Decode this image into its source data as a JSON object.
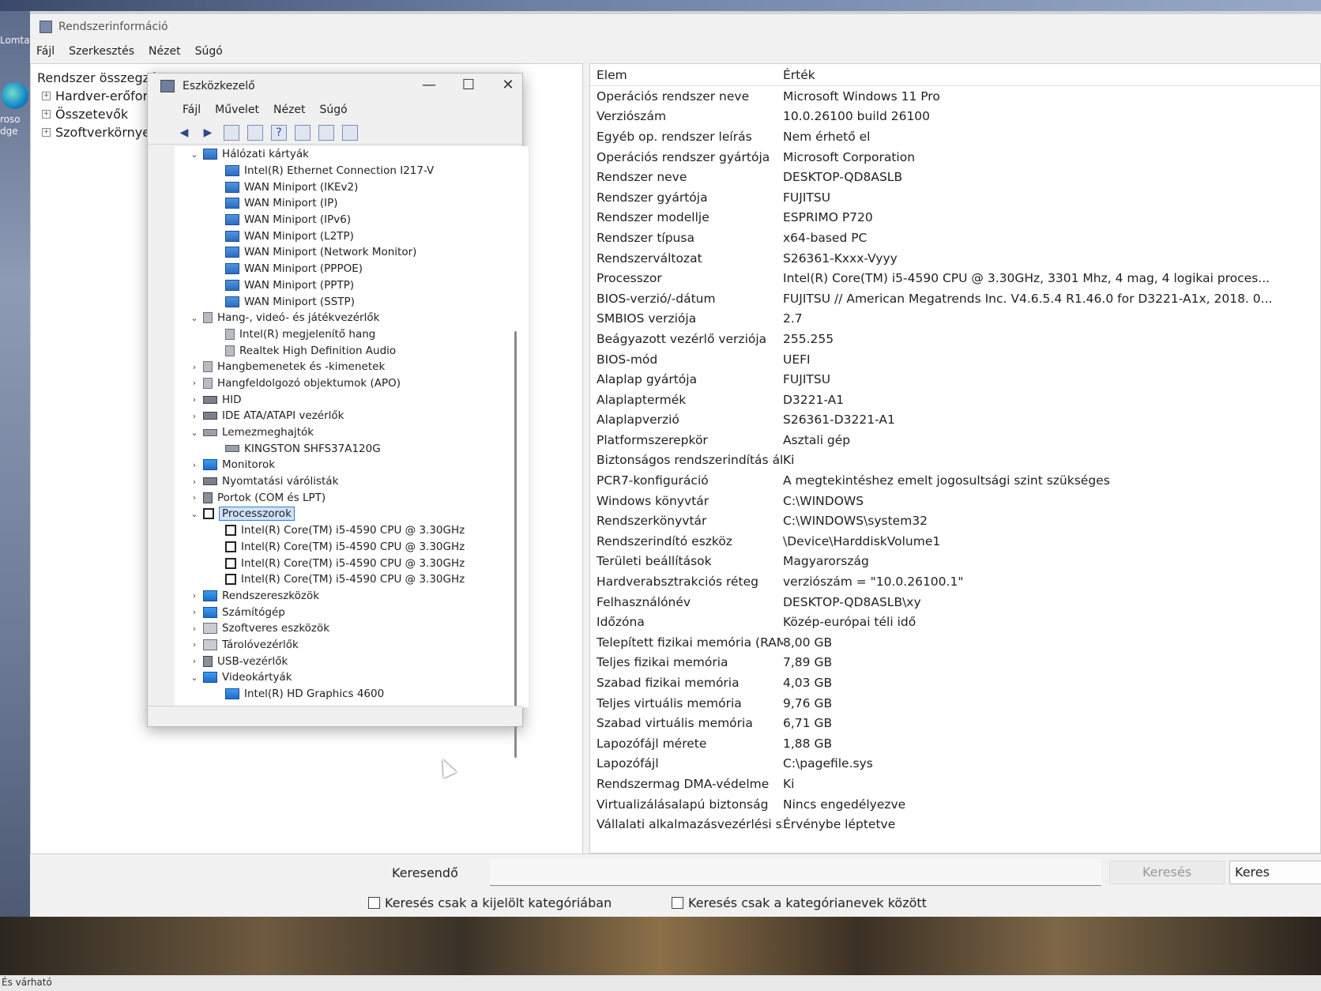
{
  "desktop": {
    "top_left_label": "Lomta",
    "left_labels": [
      "roso",
      "dge"
    ],
    "taskbar_text": "És várható"
  },
  "window": {
    "title": "Rendszerinformáció",
    "menu": [
      "Fájl",
      "Szerkesztés",
      "Nézet",
      "Súgó"
    ]
  },
  "tree": {
    "root": "Rendszer összegzése",
    "children": [
      "Hardver-erőforrások",
      "Összetevők",
      "Szoftverkörnyezet"
    ]
  },
  "info": {
    "col_elem": "Elem",
    "col_val": "Érték",
    "rows": [
      [
        "Operációs rendszer neve",
        "Microsoft Windows 11 Pro"
      ],
      [
        "Verziószám",
        "10.0.26100 build 26100"
      ],
      [
        "Egyéb op. rendszer leírás",
        "Nem érhető el"
      ],
      [
        "Operációs rendszer gyártója",
        "Microsoft Corporation"
      ],
      [
        "Rendszer neve",
        "DESKTOP-QD8ASLB"
      ],
      [
        "Rendszer gyártója",
        "FUJITSU"
      ],
      [
        "Rendszer modellje",
        "ESPRIMO P720"
      ],
      [
        "Rendszer típusa",
        "x64-based PC"
      ],
      [
        "Rendszerváltozat",
        "S26361-Kxxx-Vyyy"
      ],
      [
        "Processzor",
        "Intel(R) Core(TM) i5-4590 CPU @ 3.30GHz, 3301 Mhz, 4 mag, 4 logikai proces..."
      ],
      [
        "BIOS-verzió/-dátum",
        "FUJITSU // American Megatrends Inc. V4.6.5.4 R1.46.0 for D3221-A1x, 2018. 0..."
      ],
      [
        "SMBIOS verziója",
        "2.7"
      ],
      [
        "Beágyazott vezérlő verziója",
        "255.255"
      ],
      [
        "BIOS-mód",
        "UEFI"
      ],
      [
        "Alaplap gyártója",
        "FUJITSU"
      ],
      [
        "Alaplaptermék",
        "D3221-A1"
      ],
      [
        "Alaplapverzió",
        "S26361-D3221-A1"
      ],
      [
        "Platformszerepkör",
        "Asztali gép"
      ],
      [
        "Biztonságos rendszerindítás áll...",
        "Ki"
      ],
      [
        "PCR7-konfiguráció",
        "A megtekintéshez emelt jogosultsági szint szükséges"
      ],
      [
        "Windows könyvtár",
        "C:\\WINDOWS"
      ],
      [
        "Rendszerkönyvtár",
        "C:\\WINDOWS\\system32"
      ],
      [
        "Rendszerindító eszköz",
        "\\Device\\HarddiskVolume1"
      ],
      [
        "Területi beállítások",
        "Magyarország"
      ],
      [
        "Hardverabsztrakciós réteg",
        "verziószám = \"10.0.26100.1\""
      ],
      [
        "Felhasználónév",
        "DESKTOP-QD8ASLB\\xy"
      ],
      [
        "Időzóna",
        "Közép-európai téli idő"
      ],
      [
        "Telepített fizikai memória (RAM)",
        "8,00 GB"
      ],
      [
        "Teljes fizikai memória",
        "7,89 GB"
      ],
      [
        "Szabad fizikai memória",
        "4,03 GB"
      ],
      [
        "Teljes virtuális memória",
        "9,76 GB"
      ],
      [
        "Szabad virtuális memória",
        "6,71 GB"
      ],
      [
        "Lapozófájl mérete",
        "1,88 GB"
      ],
      [
        "Lapozófájl",
        "C:\\pagefile.sys"
      ],
      [
        "Rendszermag DMA-védelme",
        "Ki"
      ],
      [
        "Virtualizálásalapú biztonság",
        "Nincs engedélyezve"
      ],
      [
        "Vállalati alkalmazásvezérlési sz...",
        "Érvénybe léptetve"
      ]
    ]
  },
  "search": {
    "label": "Keresendő",
    "value": "",
    "btn_search_disabled": "Keresés",
    "btn_search": "Keres",
    "chk_selected": "Keresés csak a kijelölt kategóriában",
    "chk_names": "Keresés csak a kategórianevek között"
  },
  "devmgr": {
    "title": "Eszközkezelő",
    "menu": [
      "Fájl",
      "Művelet",
      "Nézet",
      "Súgó"
    ],
    "controls": [
      "—",
      "☐",
      "✕"
    ],
    "nodes": [
      {
        "label": "Hálózati kártyák",
        "chev": "v",
        "icon": "net",
        "indent": 0
      },
      {
        "label": "Intel(R) Ethernet Connection I217-V",
        "chev": "",
        "icon": "net",
        "indent": 1
      },
      {
        "label": "WAN Miniport (IKEv2)",
        "chev": "",
        "icon": "net",
        "indent": 1
      },
      {
        "label": "WAN Miniport (IP)",
        "chev": "",
        "icon": "net",
        "indent": 1
      },
      {
        "label": "WAN Miniport (IPv6)",
        "chev": "",
        "icon": "net",
        "indent": 1
      },
      {
        "label": "WAN Miniport (L2TP)",
        "chev": "",
        "icon": "net",
        "indent": 1
      },
      {
        "label": "WAN Miniport (Network Monitor)",
        "chev": "",
        "icon": "net",
        "indent": 1
      },
      {
        "label": "WAN Miniport (PPPOE)",
        "chev": "",
        "icon": "net",
        "indent": 1
      },
      {
        "label": "WAN Miniport (PPTP)",
        "chev": "",
        "icon": "net",
        "indent": 1
      },
      {
        "label": "WAN Miniport (SSTP)",
        "chev": "",
        "icon": "net",
        "indent": 1
      },
      {
        "label": "Hang-, videó- és játékvezérlők",
        "chev": "v",
        "icon": "snd",
        "indent": 0
      },
      {
        "label": "Intel(R) megjelenítő hang",
        "chev": "",
        "icon": "snd",
        "indent": 1
      },
      {
        "label": "Realtek High Definition Audio",
        "chev": "",
        "icon": "snd",
        "indent": 1
      },
      {
        "label": "Hangbemenetek és -kimenetek",
        "chev": ">",
        "icon": "snd",
        "indent": 0
      },
      {
        "label": "Hangfeldolgozó objektumok (APO)",
        "chev": ">",
        "icon": "snd",
        "indent": 0
      },
      {
        "label": "HID",
        "chev": ">",
        "icon": "hid",
        "indent": 0
      },
      {
        "label": "IDE ATA/ATAPI vezérlők",
        "chev": ">",
        "icon": "hid",
        "indent": 0
      },
      {
        "label": "Lemezmeghajtók",
        "chev": "v",
        "icon": "disk",
        "indent": 0
      },
      {
        "label": "KINGSTON SHFS37A120G",
        "chev": "",
        "icon": "disk",
        "indent": 1
      },
      {
        "label": "Monitorok",
        "chev": ">",
        "icon": "mon",
        "indent": 0
      },
      {
        "label": "Nyomtatási várólisták",
        "chev": ">",
        "icon": "hid",
        "indent": 0
      },
      {
        "label": "Portok (COM és LPT)",
        "chev": ">",
        "icon": "port",
        "indent": 0
      },
      {
        "label": "Processzorok",
        "chev": "v",
        "icon": "cpu",
        "indent": 0,
        "selected": true
      },
      {
        "label": "Intel(R) Core(TM) i5-4590 CPU @ 3.30GHz",
        "chev": "",
        "icon": "cpu",
        "indent": 1
      },
      {
        "label": "Intel(R) Core(TM) i5-4590 CPU @ 3.30GHz",
        "chev": "",
        "icon": "cpu",
        "indent": 1
      },
      {
        "label": "Intel(R) Core(TM) i5-4590 CPU @ 3.30GHz",
        "chev": "",
        "icon": "cpu",
        "indent": 1
      },
      {
        "label": "Intel(R) Core(TM) i5-4590 CPU @ 3.30GHz",
        "chev": "",
        "icon": "cpu",
        "indent": 1
      },
      {
        "label": "Rendszereszközök",
        "chev": ">",
        "icon": "mon",
        "indent": 0
      },
      {
        "label": "Számítógép",
        "chev": ">",
        "icon": "mon",
        "indent": 0
      },
      {
        "label": "Szoftveres eszközök",
        "chev": ">",
        "icon": "dev",
        "indent": 0
      },
      {
        "label": "Tárolóvezérlők",
        "chev": ">",
        "icon": "dev",
        "indent": 0
      },
      {
        "label": "USB-vezérlők",
        "chev": ">",
        "icon": "port",
        "indent": 0
      },
      {
        "label": "Videokártyák",
        "chev": "v",
        "icon": "mon",
        "indent": 0
      },
      {
        "label": "Intel(R) HD Graphics 4600",
        "chev": "",
        "icon": "mon",
        "indent": 1
      }
    ]
  }
}
